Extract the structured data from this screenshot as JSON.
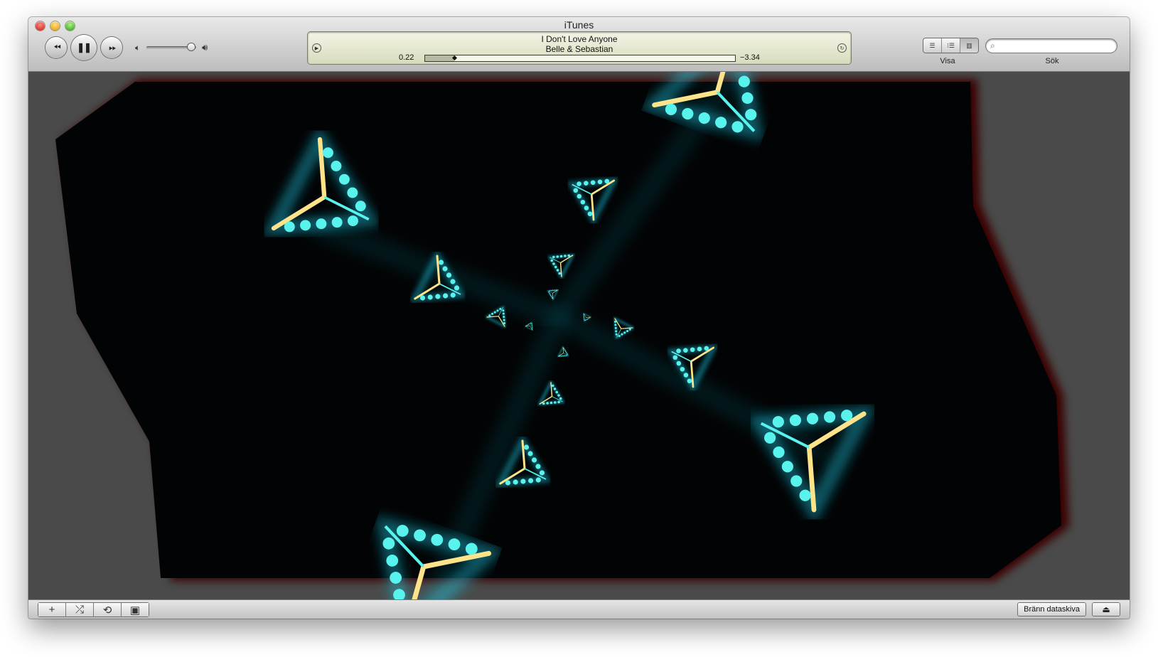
{
  "window": {
    "title": "iTunes"
  },
  "controls": {
    "previous_icon": "⏪︎",
    "play_pause_icon": "❚❚",
    "next_icon": "⏩︎",
    "volume_level": 0.9
  },
  "now_playing": {
    "song": "I Don't Love Anyone",
    "artist": "Belle & Sebastian",
    "elapsed": "0.22",
    "remaining": "−3.34",
    "progress": 0.095
  },
  "view": {
    "label": "Visa",
    "options": [
      "list-view",
      "grid-view",
      "coverflow-view"
    ],
    "selected": "coverflow-view"
  },
  "search": {
    "label": "Sök",
    "placeholder": ""
  },
  "bottom": {
    "add_icon": "+",
    "shuffle_icon": "⤮",
    "repeat_icon": "⟲",
    "artwork_icon": "▣",
    "burn_label": "Bränn dataskiva",
    "eject_icon": "⏏"
  },
  "visualizer": {
    "colors": {
      "background": "#020304",
      "glow": "#18c6e0",
      "dot": "#59f3ee",
      "edge": "#ffe38a",
      "frame": "#4a4a4a",
      "red_glow": "#4a0505"
    }
  }
}
